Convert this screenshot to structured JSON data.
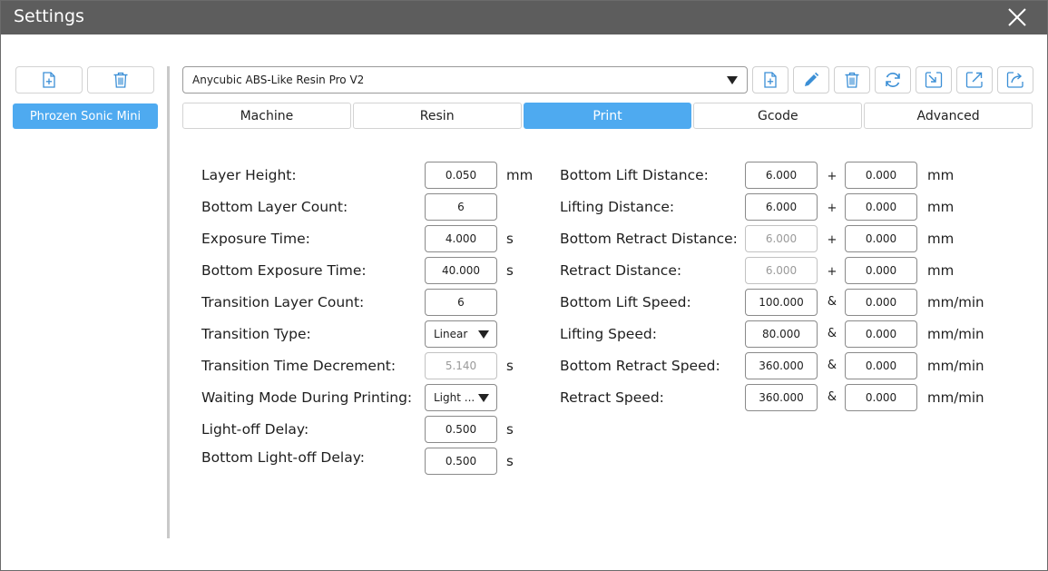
{
  "window": {
    "title": "Settings"
  },
  "sidebar": {
    "printers": [
      {
        "label": "Phrozen Sonic Mini",
        "selected": true
      }
    ]
  },
  "toolbar": {
    "profile": "Anycubic ABS-Like Resin Pro V2",
    "icons": [
      "add-file-icon",
      "edit-pencil-icon",
      "trash-icon",
      "refresh-icon",
      "import-icon",
      "export-icon",
      "share-icon"
    ]
  },
  "tabs": [
    {
      "label": "Machine"
    },
    {
      "label": "Resin"
    },
    {
      "label": "Print",
      "active": true
    },
    {
      "label": "Gcode"
    },
    {
      "label": "Advanced"
    }
  ],
  "left_form": [
    {
      "label": "Layer Height:",
      "value": "0.050",
      "unit": "mm"
    },
    {
      "label": "Bottom Layer Count:",
      "value": "6",
      "unit": ""
    },
    {
      "label": "Exposure Time:",
      "value": "4.000",
      "unit": "s"
    },
    {
      "label": "Bottom Exposure Time:",
      "value": "40.000",
      "unit": "s"
    },
    {
      "label": "Transition Layer Count:",
      "value": "6",
      "unit": ""
    },
    {
      "label": "Transition Type:",
      "value": "Linear",
      "unit": ""
    },
    {
      "label": "Transition Time Decrement:",
      "value": "5.140",
      "unit": "s"
    },
    {
      "label": "Waiting Mode During Printing:",
      "value": "Light ...",
      "unit": ""
    },
    {
      "label": "Light-off Delay:",
      "value": "0.500",
      "unit": "s"
    },
    {
      "label": "Bottom Light-off Delay:",
      "value": "0.500",
      "unit": "s"
    }
  ],
  "right_form": [
    {
      "label": "Bottom Lift Distance:",
      "value": "6.000",
      "op": "+",
      "value2": "0.000",
      "unit": "mm"
    },
    {
      "label": "Lifting Distance:",
      "value": "6.000",
      "op": "+",
      "value2": "0.000",
      "unit": "mm"
    },
    {
      "label": "Bottom Retract Distance:",
      "value": "6.000",
      "op": "+",
      "value2": "0.000",
      "unit": "mm"
    },
    {
      "label": "Retract Distance:",
      "value": "6.000",
      "op": "+",
      "value2": "0.000",
      "unit": "mm"
    },
    {
      "label": "Bottom Lift Speed:",
      "value": "100.000",
      "op": "&",
      "value2": "0.000",
      "unit": "mm/min"
    },
    {
      "label": "Lifting Speed:",
      "value": "80.000",
      "op": "&",
      "value2": "0.000",
      "unit": "mm/min"
    },
    {
      "label": "Bottom Retract Speed:",
      "value": "360.000",
      "op": "&",
      "value2": "0.000",
      "unit": "mm/min"
    },
    {
      "label": "Retract Speed:",
      "value": "360.000",
      "op": "&",
      "value2": "0.000",
      "unit": "mm/min"
    }
  ],
  "colors": {
    "accent": "#4eaaf0",
    "titlebar": "#5d5d5d",
    "icon": "#3b8fd6"
  }
}
